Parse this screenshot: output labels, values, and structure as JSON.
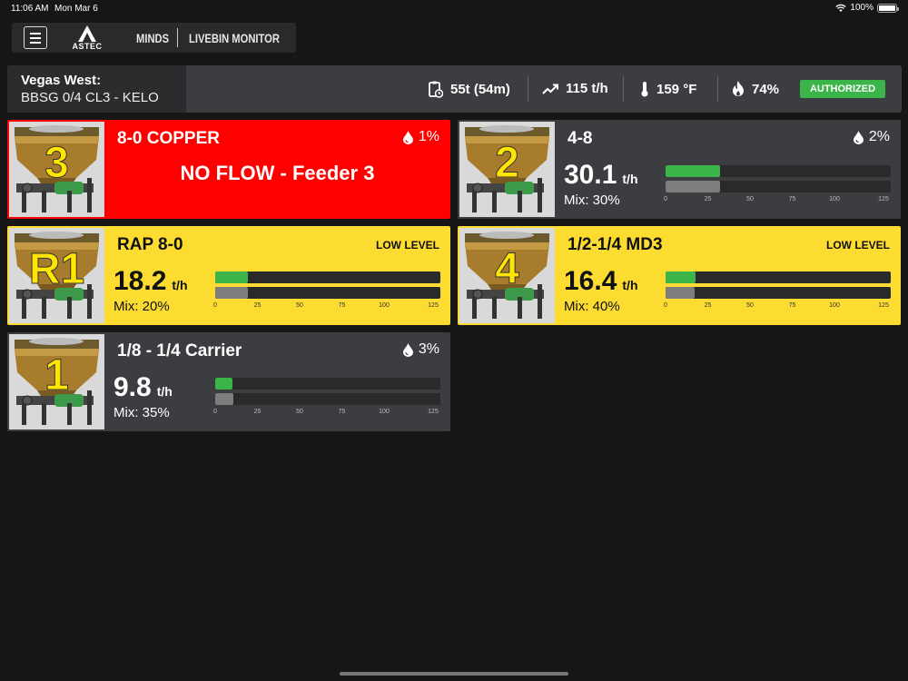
{
  "status_bar": {
    "time": "11:06 AM",
    "date": "Mon Mar 6",
    "battery": "100%"
  },
  "nav": {
    "logo_text": "ASTEC",
    "product": "MINDS",
    "app_title": "LIVEBIN MONITOR"
  },
  "info": {
    "plant": "Vegas West:",
    "recipe": "BBSG 0/4 CL3 - KELO",
    "tons": "55t (54m)",
    "rate": "115 t/h",
    "temperature": "159 °F",
    "burner": "74%",
    "status": "AUTHORIZED"
  },
  "colors": {
    "red": "#ff0000",
    "yellow": "#fddc31",
    "gray": "#3b3d40",
    "green": "#3bb54a",
    "bar_gray": "#7d7d7d"
  },
  "axis_ticks": [
    "0",
    "25",
    "50",
    "75",
    "100",
    "125"
  ],
  "axis_max": 125,
  "bins": [
    {
      "number": "3",
      "title": "8-0 COPPER",
      "state": "red",
      "moisture": "1%",
      "alert": "NO FLOW - Feeder 3"
    },
    {
      "number": "2",
      "title": "4-8",
      "state": "gray",
      "moisture": "2%",
      "rate_value": "30.1",
      "rate_unit": "t/h",
      "mix": "Mix: 30%",
      "actual": 30.1,
      "target": 30
    },
    {
      "number": "R1",
      "title": "RAP 8-0",
      "state": "yellow",
      "badge": "LOW LEVEL",
      "rate_value": "18.2",
      "rate_unit": "t/h",
      "mix": "Mix: 20%",
      "actual": 18.2,
      "target": 18
    },
    {
      "number": "4",
      "title": "1/2-1/4 MD3",
      "state": "yellow",
      "badge": "LOW LEVEL",
      "rate_value": "16.4",
      "rate_unit": "t/h",
      "mix": "Mix: 40%",
      "actual": 16.4,
      "target": 16
    },
    {
      "number": "1",
      "title": "1/8 - 1/4 Carrier",
      "state": "gray",
      "moisture": "3%",
      "rate_value": "9.8",
      "rate_unit": "t/h",
      "mix": "Mix: 35%",
      "actual": 9.8,
      "target": 10
    }
  ]
}
